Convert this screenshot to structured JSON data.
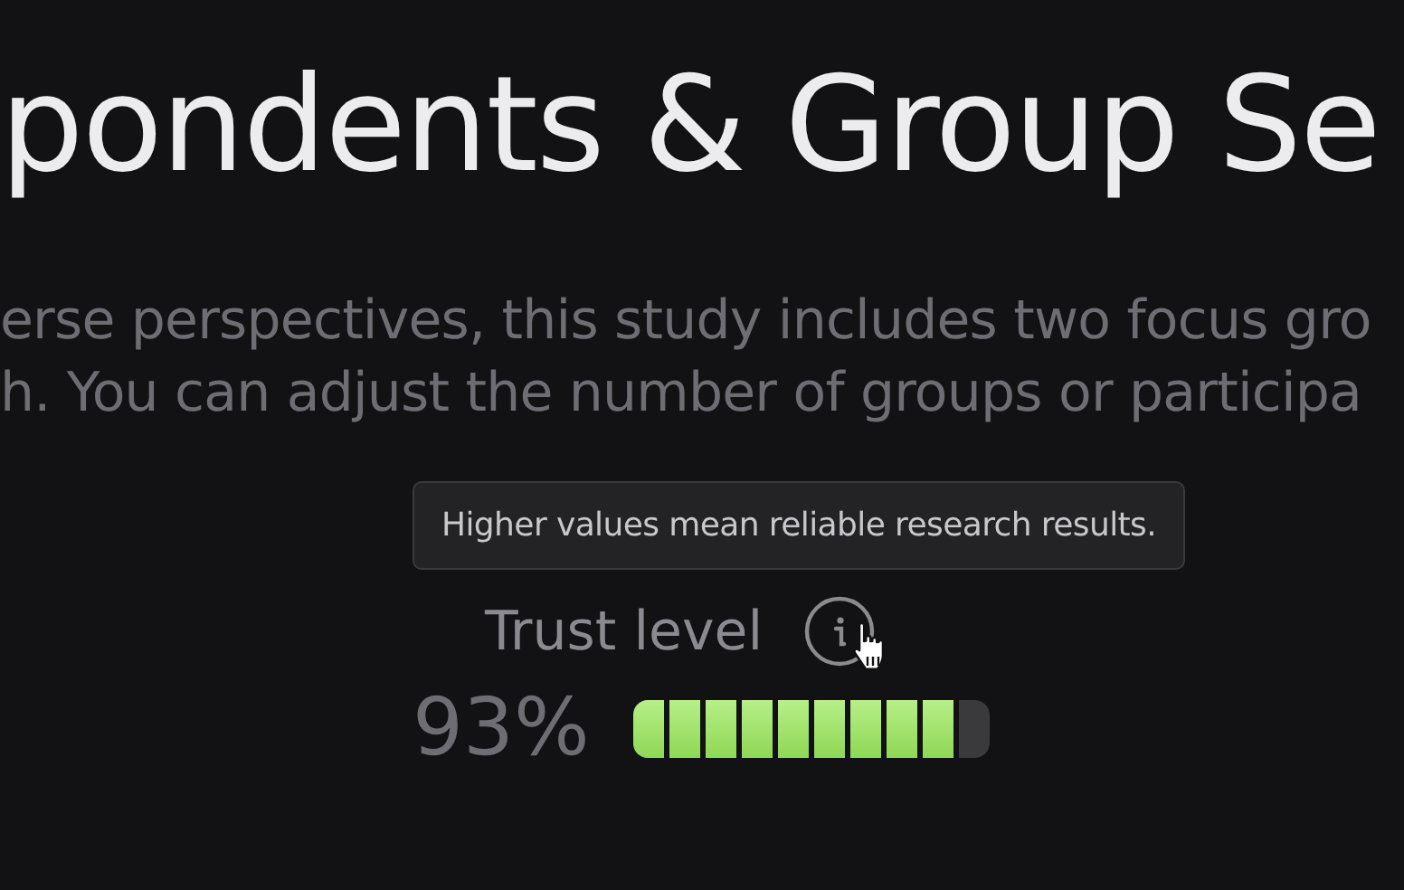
{
  "heading": "pondents & Group Se",
  "description": [
    "erse perspectives, this study includes two focus gro",
    "h. You can adjust the number of groups or participa"
  ],
  "tooltip": "Higher values mean reliable research results.",
  "trust": {
    "label": "Trust level",
    "value": "93%",
    "level": 0.9
  }
}
